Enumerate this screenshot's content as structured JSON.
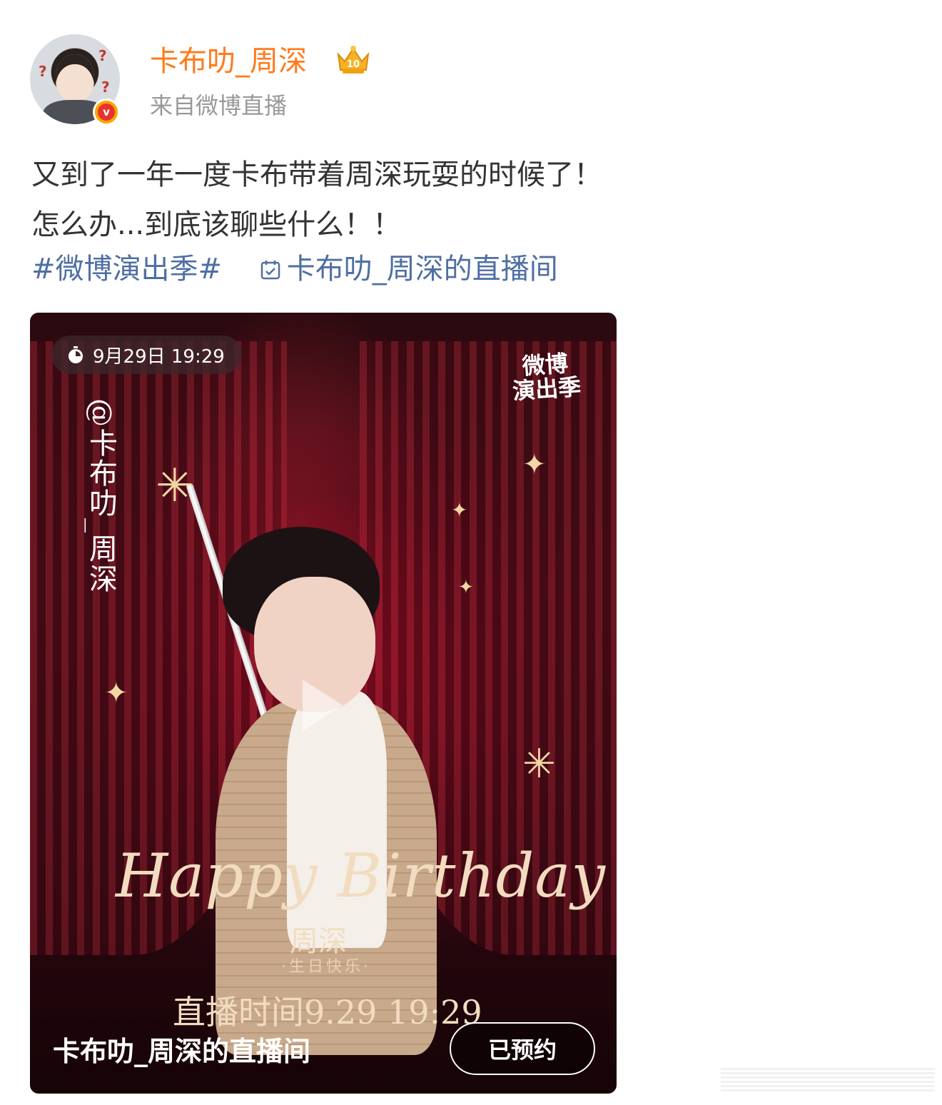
{
  "post": {
    "username": "卡布叻_周深",
    "source": "来自微博直播",
    "badge_level": "10",
    "content_lines": [
      "又到了一年一度卡布带着周深玩耍的时候了！",
      "怎么办...到底该聊些什么！！"
    ],
    "hashtag": "#微博演出季#",
    "live_link": "卡布叻_周深的直播间"
  },
  "card": {
    "time": "9月29日 19:29",
    "brand_line1": "微博",
    "brand_line2": "演出季",
    "at_name": "@卡布叻_周深",
    "happy_birthday": "Happy Birthday",
    "name": "周深",
    "sub": "·生日快乐·",
    "live_time": "直播时间9.29 19:29",
    "title": "卡布叻_周深的直播间",
    "booked_label": "已预约"
  }
}
